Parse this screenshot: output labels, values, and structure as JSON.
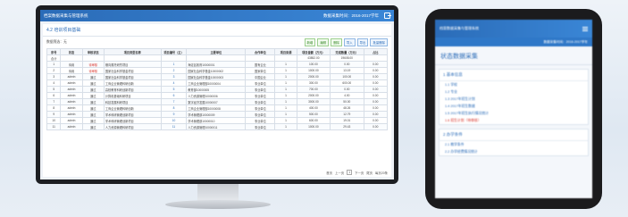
{
  "app": {
    "title": "档案数据采集与管理系统",
    "user_info": "数据采集时间：2016-2017学年"
  },
  "panel": {
    "title": "4.2 培训项目基础",
    "filter_label": "数据筛选：无"
  },
  "toolbar": {
    "buttons": [
      "新增",
      "编辑",
      "删除",
      "导入",
      "导出",
      "批量删除"
    ]
  },
  "table": {
    "headers": [
      "序号",
      "状态",
      "审核状态",
      "项目类型名称",
      "项目编号（主）",
      "主要单位",
      "合作单位",
      "项目来源",
      "项目金额（万元）",
      "完成数量（万元）",
      "占比"
    ],
    "rows": [
      [
        "合计",
        "",
        "",
        "",
        "",
        "",
        "",
        "",
        "43852.00",
        "19608.00",
        ""
      ],
      [
        "1",
        "待用",
        "待审核",
        "横向委托研究项目",
        "1",
        "海淀区政府10000001",
        "国有企业",
        "1",
        "100.00",
        "0.00",
        "0.00"
      ],
      [
        "2",
        "待用",
        "待审核",
        "国家社会科学基金项目",
        "2",
        "国家社会科学基金10000002",
        "国家单位",
        "1",
        "1000.00",
        "13.19",
        "0.00"
      ],
      [
        "3",
        "admin",
        "通过",
        "国家社会科学基金项目",
        "3",
        "国家社会科学基金10000003",
        "中国企业",
        "1",
        "2000.00",
        "100.00",
        "0.00"
      ],
      [
        "4",
        "admin",
        "通过",
        "工商企业管理科研创新",
        "4",
        "工商企业管理部10000004",
        "事业单位",
        "1",
        "300.00",
        "600.00",
        "0.00"
      ],
      [
        "5",
        "admin",
        "通过",
        "高校教育科研创新项目",
        "5",
        "教育部10000005",
        "事业单位",
        "1",
        "700.00",
        "0.00",
        "0.00"
      ],
      [
        "6",
        "admin",
        "通过",
        "计算机基础科研项目",
        "6",
        "人力资源管理10000006",
        "事业单位",
        "1",
        "2000.00",
        "4.00",
        "0.00"
      ],
      [
        "7",
        "admin",
        "通过",
        "科技发展科研项目",
        "7",
        "数字经济发展10000007",
        "事业单位",
        "1",
        "3000.00",
        "50.00",
        "0.00"
      ],
      [
        "8",
        "admin",
        "通过",
        "工商企业管理科研创新",
        "8",
        "工商企业管理部10000008",
        "事业单位",
        "1",
        "400.00",
        "48.26",
        "0.00"
      ],
      [
        "9",
        "admin",
        "通过",
        "学术科研管理创新项目",
        "9",
        "学术管理部10000009",
        "事业单位",
        "1",
        "500.00",
        "12.79",
        "0.00"
      ],
      [
        "10",
        "admin",
        "通过",
        "学术科研管理创新项目",
        "10",
        "学术管理部10000010",
        "事业单位",
        "1",
        "600.00",
        "19.01",
        "0.00"
      ],
      [
        "11",
        "admin",
        "通过",
        "人力资源管理科研项目",
        "11",
        "人力资源管理10000011",
        "事业单位",
        "1",
        "1000.00",
        "29.43",
        "0.00"
      ]
    ]
  },
  "pager": {
    "first": "首页",
    "prev": "上一页",
    "current": "1",
    "next": "下一页",
    "last": "尾页",
    "page_size": "每页20条"
  },
  "phone": {
    "header_title": "档案数据采集与管理系统",
    "sub_info": "数据采集时间：2016-2017学年",
    "page_title": "状态数据采集",
    "section1_title": "1 基本信息",
    "section1_items": [
      "1.1 学校",
      "1.2 专业",
      "1.3 2017年招生计划",
      "1.4 2017年招生数据",
      "1.5 2017年招生执行情况统计",
      "1.6 招生计划（待审核）"
    ],
    "section2_title": "2 办学条件",
    "section2_items": [
      "2.1 教学条件",
      "2.2 办学经费情况统计"
    ]
  },
  "colors": {
    "brand": "#2b6cb8",
    "accent_green": "#3a8a2a",
    "alert_red": "#d9342b"
  }
}
